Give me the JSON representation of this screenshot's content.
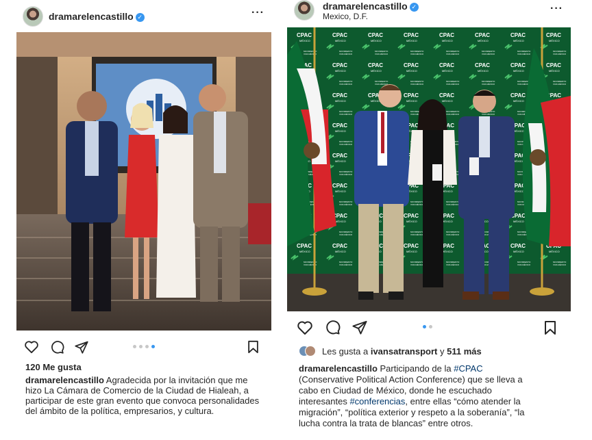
{
  "left_post": {
    "username": "dramarelencastillo",
    "likes_count": "120",
    "likes_label": "Me gusta",
    "caption_user": "dramarelencastillo",
    "caption_lines": [
      "Agradecida por la invitación que me",
      "hizo La Cámara de Comercio de la Ciudad de Hialeah, a",
      "participar de este gran evento que convoca personalidades",
      "del ámbito de la política, empresarios, y cultura."
    ],
    "carousel": {
      "total": 4,
      "active": 4
    }
  },
  "right_post": {
    "username": "dramarelencastillo",
    "location": "Mexico, D.F.",
    "likes_prefix": "Les gusta a",
    "likes_user": "ivansatransport",
    "likes_connector": "y",
    "likes_more": "511 más",
    "caption_user": "dramarelencastillo",
    "caption": {
      "l1_text": "Participando de la",
      "l1_tag": "#CPAC",
      "l2": "(Conservative Political Action Conference) que se lleva a",
      "l3": "cabo en Ciudad de México, donde he escuchado",
      "l4_text_a": "interesantes",
      "l4_tag": "#conferencias",
      "l4_text_b": ", entre ellas “cómo atender la",
      "l5": "migración”, “política exterior y respeto a la soberanía”, “la",
      "l6": "lucha contra la trata de blancas” entre otros."
    },
    "carousel": {
      "total": 2,
      "active": 1
    },
    "backdrop_text": [
      "CPAC",
      "MÉXICO",
      "MOVIMIENTO",
      "VIVA MÉXICO"
    ]
  },
  "icons": [
    "heart-icon",
    "comment-icon",
    "share-icon",
    "bookmark-icon",
    "more-icon",
    "verified-icon"
  ],
  "colors": {
    "verified": "#3897f0",
    "carousel_active": "#3897f0",
    "hashtag": "#00376b"
  }
}
